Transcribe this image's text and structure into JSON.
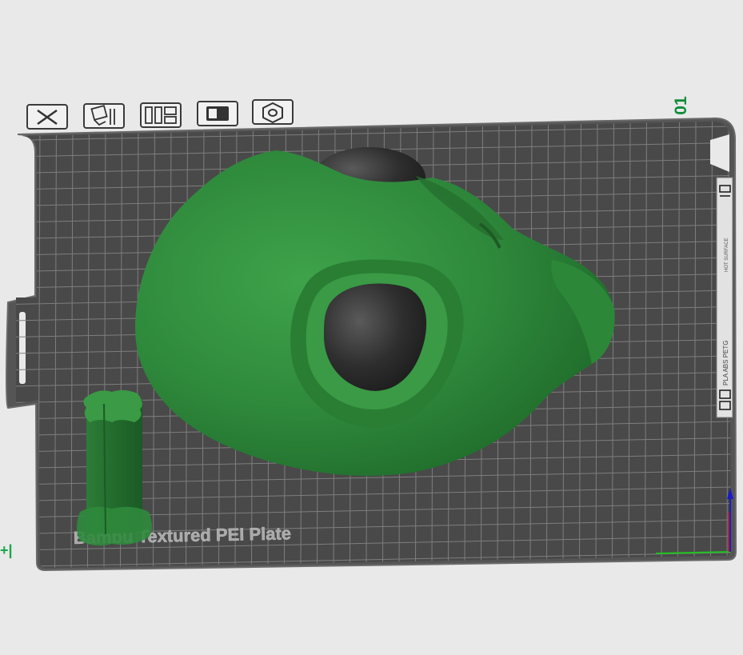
{
  "plate": {
    "number": "01",
    "label": "Bambu Textured PEI Plate",
    "side_label_top": "HOT SURFACE",
    "side_label_filaments": "PLA ABS PETG"
  },
  "toolbar": {
    "buttons": [
      {
        "name": "remove-plate-button",
        "icon": "close-icon"
      },
      {
        "name": "arrange-button",
        "icon": "arrange-icon"
      },
      {
        "name": "auto-orient-button",
        "icon": "layout-icon"
      },
      {
        "name": "lock-plate-button",
        "icon": "lock-icon"
      },
      {
        "name": "plate-settings-button",
        "icon": "hex-nut-icon"
      }
    ]
  },
  "colors": {
    "background": "#e9e9e9",
    "plate": "#4a4a4a",
    "grid": "#7c7c7c",
    "model_green": "#2f8a3c",
    "model_dark": "#2b2b2b",
    "axis_x": "#1fc21f",
    "axis_y": "#1a1acc",
    "axis_z": "#cc1a1a",
    "accent": "#0f8c3a"
  },
  "side_marker": "+|"
}
